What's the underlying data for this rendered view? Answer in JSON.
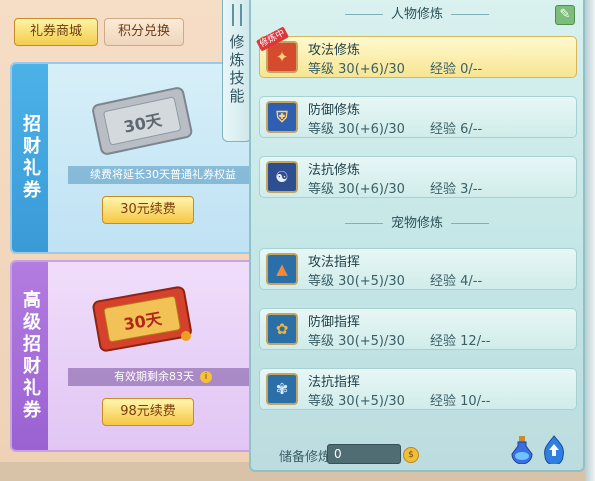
{
  "shop": {
    "tabs": [
      {
        "label": "礼券商城",
        "active": true
      },
      {
        "label": "积分兑换",
        "active": false
      }
    ],
    "cards": [
      {
        "side_title": "招财礼券",
        "ticket_text": "30天",
        "info": "续费将延长30天普通礼券权益",
        "button": "30元续费"
      },
      {
        "side_title": "高级招财礼券",
        "ticket_text": "30天",
        "info": "有效期剩余83天",
        "button": "98元续费"
      }
    ]
  },
  "skill_tab": {
    "label": "修炼技能"
  },
  "panel": {
    "sections": [
      {
        "title": "人物修炼",
        "items": [
          {
            "name": "攻法修炼",
            "level_label": "等级",
            "level": "30(+6)/30",
            "exp_label": "经验",
            "exp": "0/--",
            "selected": true,
            "tag": "修炼中",
            "icon": "attack-magic-icon"
          },
          {
            "name": "防御修炼",
            "level_label": "等级",
            "level": "30(+6)/30",
            "exp_label": "经验",
            "exp": "6/--",
            "selected": false,
            "icon": "defense-icon"
          },
          {
            "name": "法抗修炼",
            "level_label": "等级",
            "level": "30(+6)/30",
            "exp_label": "经验",
            "exp": "3/--",
            "selected": false,
            "icon": "magic-resist-icon"
          }
        ]
      },
      {
        "title": "宠物修炼",
        "items": [
          {
            "name": "攻法指挥",
            "level_label": "等级",
            "level": "30(+5)/30",
            "exp_label": "经验",
            "exp": "4/--",
            "selected": false,
            "icon": "pet-attack-icon"
          },
          {
            "name": "防御指挥",
            "level_label": "等级",
            "level": "30(+5)/30",
            "exp_label": "经验",
            "exp": "12/--",
            "selected": false,
            "icon": "pet-defense-icon"
          },
          {
            "name": "法抗指挥",
            "level_label": "等级",
            "level": "30(+5)/30",
            "exp_label": "经验",
            "exp": "10/--",
            "selected": false,
            "icon": "pet-resist-icon"
          }
        ]
      }
    ],
    "reserve": {
      "label": "储备修炼",
      "value": "0"
    }
  },
  "colors": {
    "panel_bg": "#cbe9e8",
    "selected_row": "#f7e592",
    "button_gold": "#f5c844",
    "tag_red": "#e0353a"
  }
}
